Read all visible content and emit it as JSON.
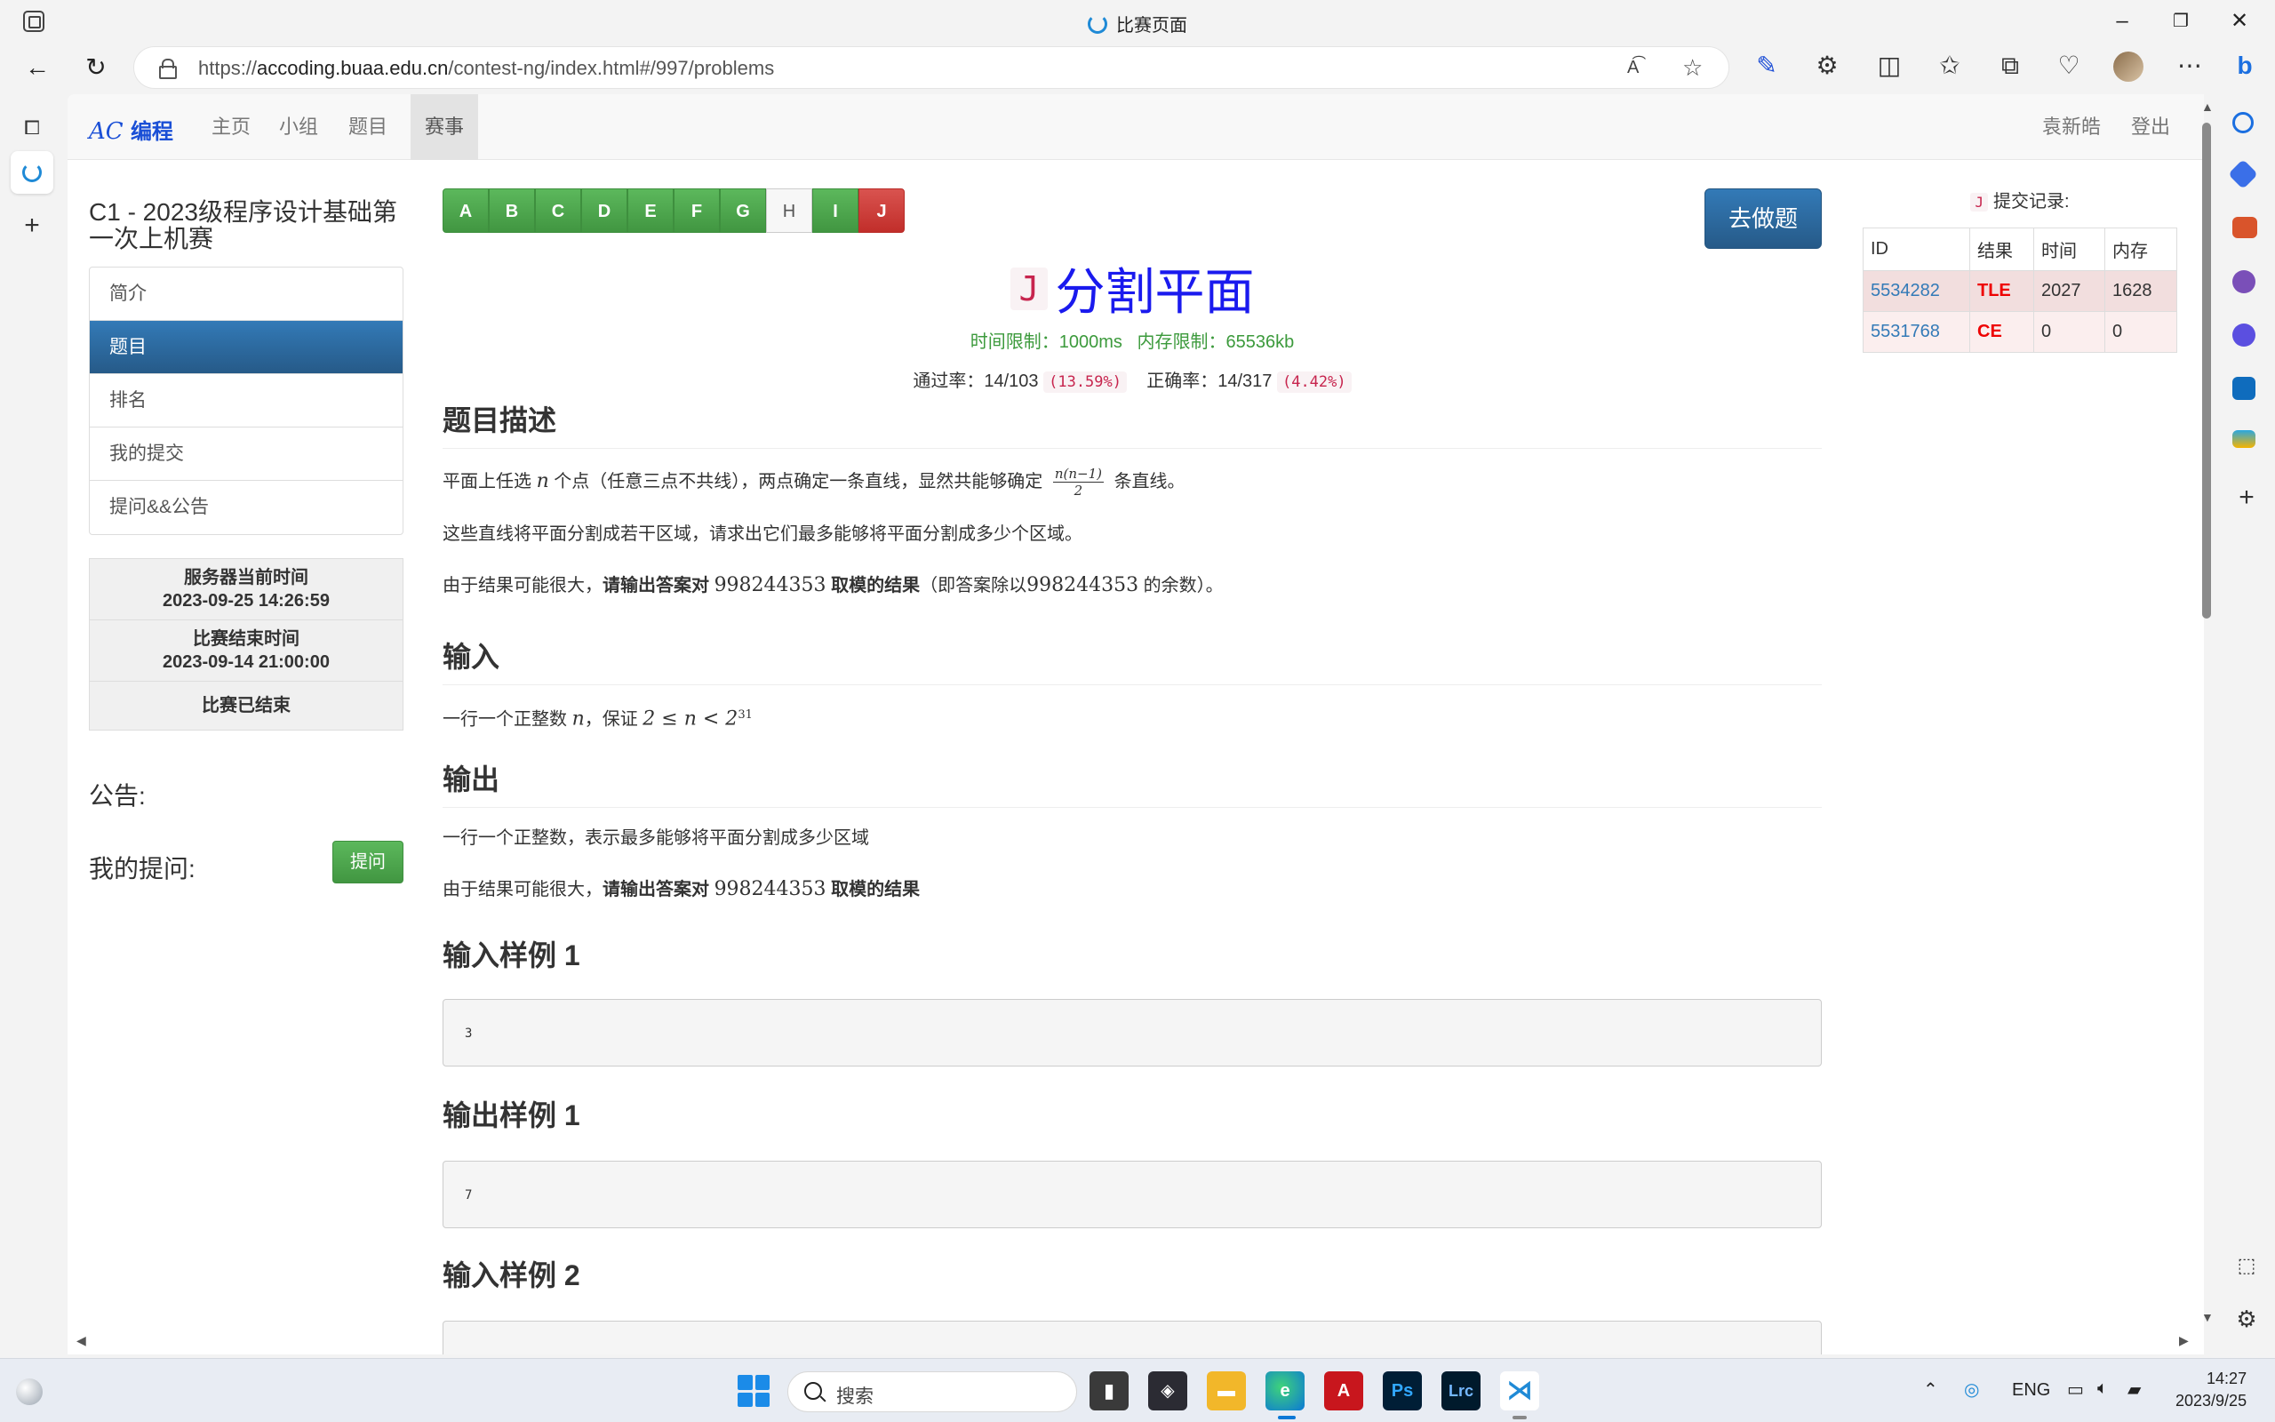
{
  "window": {
    "title": "比赛页面"
  },
  "browser": {
    "url_prefix": "https://",
    "url_host": "accoding.buaa.edu.cn",
    "url_path": "/contest-ng/index.html#/997/problems"
  },
  "site": {
    "brand_italic": "AC",
    "brand_text": "编程",
    "nav": [
      "主页",
      "小组",
      "题目",
      "赛事"
    ],
    "user": "袁新皓",
    "logout": "登出"
  },
  "sidebar": {
    "contest_title": "C1 - 2023级程序设计基础第一次上机赛",
    "menu": [
      "简介",
      "题目",
      "排名",
      "我的提交",
      "提问&&公告"
    ],
    "server_time_label": "服务器当前时间",
    "server_time": "2023-09-25 14:26:59",
    "end_time_label": "比赛结束时间",
    "end_time": "2023-09-14 21:00:00",
    "status": "比赛已结束",
    "announcement_label": "公告:",
    "my_questions_label": "我的提问:",
    "ask_button": "提问"
  },
  "problem_tabs": [
    {
      "label": "A",
      "state": "ac"
    },
    {
      "label": "B",
      "state": "ac"
    },
    {
      "label": "C",
      "state": "ac"
    },
    {
      "label": "D",
      "state": "ac"
    },
    {
      "label": "E",
      "state": "ac"
    },
    {
      "label": "F",
      "state": "ac"
    },
    {
      "label": "G",
      "state": "ac"
    },
    {
      "label": "H",
      "state": "none"
    },
    {
      "label": "I",
      "state": "ac"
    },
    {
      "label": "J",
      "state": "fail"
    }
  ],
  "go_button": "去做题",
  "problem": {
    "code": "J",
    "name": "分割平面",
    "time_limit_label": "时间限制：",
    "time_limit": "1000ms",
    "memory_limit_label": "内存限制：",
    "memory_limit": "65536kb",
    "pass_label": "通过率：",
    "pass_value": "14/103",
    "pass_pct": "(13.59%)",
    "correct_label": "正确率：",
    "correct_value": "14/317",
    "correct_pct": "(4.42%)"
  },
  "content": {
    "desc_heading": "题目描述",
    "desc_p1_a": "平面上任选",
    "desc_p1_n": "n",
    "desc_p1_b": "个点（任意三点不共线），两点确定一条直线，显然共能够确定",
    "desc_p1_frac_num": "n(n−1)",
    "desc_p1_frac_den": "2",
    "desc_p1_c": "条直线。",
    "desc_p2": "这些直线将平面分割成若干区域，请求出它们最多能够将平面分割成多少个区域。",
    "desc_p3_a": "由于结果可能很大，",
    "desc_p3_bold_a": "请输出答案对",
    "desc_p3_mod": "998244353",
    "desc_p3_bold_b": "取模的结果",
    "desc_p3_b": "（即答案除以",
    "desc_p3_mod2": "998244353",
    "desc_p3_c": "的余数）。",
    "input_heading": "输入",
    "input_p_a": "一行一个正整数",
    "input_p_n": "n",
    "input_p_b": "，保证",
    "input_p_math": "2 ≤ n < 2",
    "input_p_exp": "31",
    "output_heading": "输出",
    "output_p1": "一行一个正整数，表示最多能够将平面分割成多少区域",
    "output_p2_a": "由于结果可能很大，",
    "output_p2_bold_a": "请输出答案对",
    "output_p2_mod": "998244353",
    "output_p2_bold_b": "取模的结果",
    "sample_in1_heading": "输入样例 1",
    "sample_in1": "3",
    "sample_out1_heading": "输出样例 1",
    "sample_out1": "7",
    "sample_in2_heading": "输入样例 2"
  },
  "submissions": {
    "code": "J",
    "title": "提交记录:",
    "headers": [
      "ID",
      "结果",
      "时间",
      "内存"
    ],
    "rows": [
      {
        "id": "5534282",
        "result": "TLE",
        "time": "2027",
        "memory": "1628"
      },
      {
        "id": "5531768",
        "result": "CE",
        "time": "0",
        "memory": "0"
      }
    ]
  },
  "taskbar": {
    "search_placeholder": "搜索",
    "lang": "ENG",
    "time": "14:27",
    "date": "2023/9/25"
  }
}
